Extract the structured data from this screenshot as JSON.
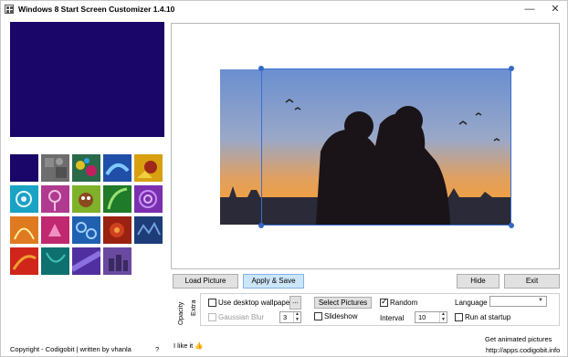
{
  "window": {
    "title": "Windows 8 Start Screen Customizer 1.4.10",
    "minimize_glyph": "—",
    "close_glyph": "✕"
  },
  "preview_color": "#1a0568",
  "tiles": [
    {
      "color": "#1a0568"
    },
    {
      "color": "#6d6d6d"
    },
    {
      "color": "#2a6a4a"
    },
    {
      "color": "#1f4fa8"
    },
    {
      "color": "#d8a010"
    },
    {
      "color": "#1aa3c4"
    },
    {
      "color": "#b03a90"
    },
    {
      "color": "#7fb22a"
    },
    {
      "color": "#1f7a2a"
    },
    {
      "color": "#7a2fb0"
    },
    {
      "color": "#e07a20"
    },
    {
      "color": "#c02870"
    },
    {
      "color": "#2060b0"
    },
    {
      "color": "#9a2210"
    },
    {
      "color": "#1e3c78"
    },
    {
      "color": "#d0261a"
    },
    {
      "color": "#0f7070"
    },
    {
      "color": "#5030a0"
    },
    {
      "color": "#6a4aa0"
    }
  ],
  "buttons": {
    "load_picture": "Load Picture",
    "apply_save": "Apply & Save",
    "hide": "Hide",
    "exit": "Exit",
    "ellipsis": "...",
    "select_pictures": "Select Pictures"
  },
  "tabs": {
    "opacity": "Opacity",
    "extra": "Extra"
  },
  "options": {
    "use_desktop_wallpaper": {
      "label": "Use desktop wallpaper",
      "checked": false
    },
    "gaussian_blur": {
      "label": "Gaussian Blur",
      "checked": false,
      "value": "3"
    },
    "random": {
      "label": "Random",
      "checked": true
    },
    "slideshow": {
      "label": "Slideshow",
      "checked": false
    },
    "language_label": "Language",
    "language_value": "",
    "interval_label": "Interval",
    "interval_value": "10",
    "run_at_startup": {
      "label": "Run at startup",
      "checked": false
    }
  },
  "footer": {
    "copyright": "Copyright - Codigobit | written by vhanla",
    "help": "?",
    "like": "I like it",
    "like_icon": "thumbs-up-icon",
    "animated": "Get animated pictures",
    "url": "http://apps.codigobit.info"
  }
}
